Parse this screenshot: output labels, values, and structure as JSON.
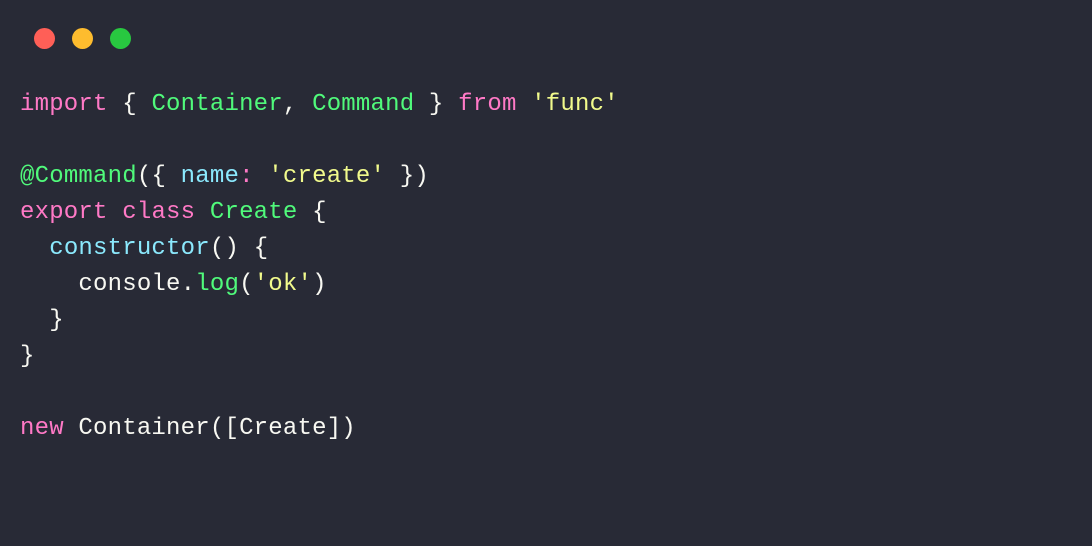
{
  "code": {
    "import_kw": "import",
    "lbrace": "{",
    "container": "Container",
    "comma1": ",",
    "command": "Command",
    "rbrace": "}",
    "from_kw": "from",
    "funcstr": "'func'",
    "at": "@",
    "command_deco": "Command",
    "lparen": "(",
    "lbrace2": "{",
    "name_prop": "name",
    "colon": ":",
    "createstr": "'create'",
    "rbrace2": "}",
    "rparen": ")",
    "export_kw": "export",
    "class_kw": "class",
    "create_cls": "Create",
    "lbrace3": "{",
    "constructor_kw": "constructor",
    "lparen2": "(",
    "rparen2": ")",
    "lbrace4": "{",
    "console": "console",
    "dot": ".",
    "log": "log",
    "lparen3": "(",
    "okstr": "'ok'",
    "rparen3": ")",
    "rbrace4": "}",
    "rbrace3": "}",
    "new_kw": "new",
    "container2": "Container",
    "lparen4": "(",
    "lbracket": "[",
    "create_ref": "Create",
    "rbracket": "]",
    "rparen4": ")"
  }
}
